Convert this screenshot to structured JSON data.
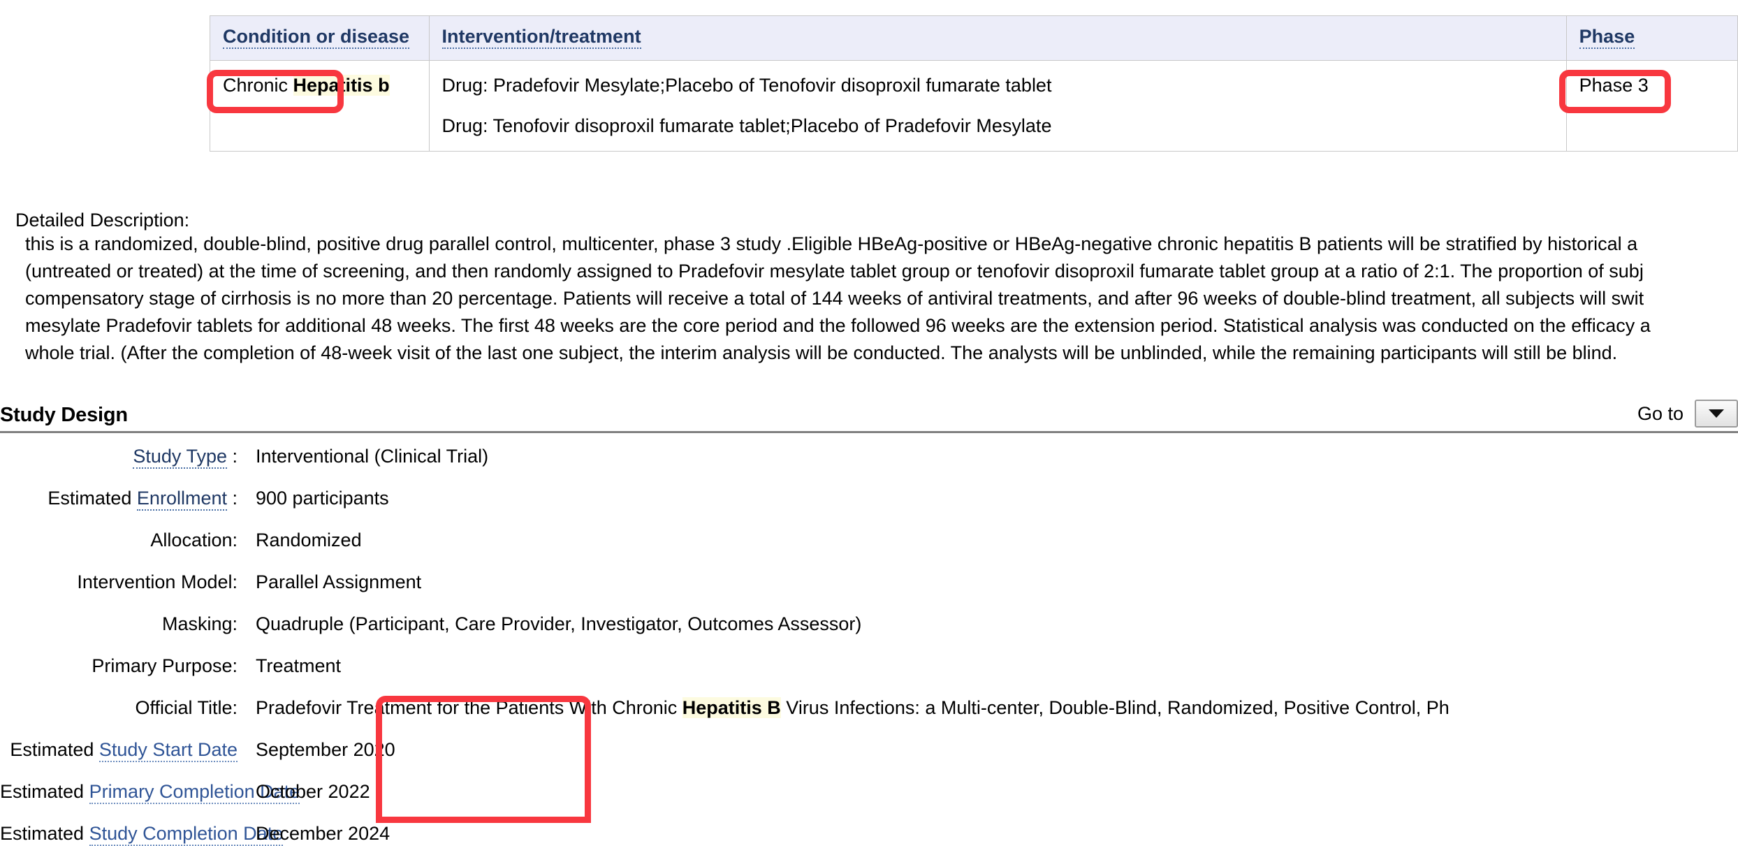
{
  "table": {
    "headers": [
      {
        "label": "Condition or disease",
        "name": "condition-or-disease"
      },
      {
        "label": "Intervention/treatment",
        "name": "intervention-treatment"
      },
      {
        "label": "Phase",
        "name": "phase"
      }
    ],
    "row": {
      "condition_prefix": "Chronic ",
      "condition_highlight": "Hepatitis b",
      "intervention_line_1": "Drug: Pradefovir Mesylate;Placebo of Tenofovir disoproxil fumarate tablet",
      "intervention_line_2": "Drug: Tenofovir disoproxil fumarate tablet;Placebo of Pradefovir Mesylate",
      "phase": "Phase 3"
    }
  },
  "detailed_description": {
    "label": "Detailed Description:",
    "line_1": "this is a randomized, double-blind, positive drug parallel control, multicenter, phase 3 study .Eligible HBeAg-positive or HBeAg-negative chronic hepatitis B patients will be stratified by historical a",
    "line_2": "(untreated or treated) at the time of screening, and then randomly assigned to Pradefovir mesylate tablet group or tenofovir disoproxil fumarate tablet group at a ratio of 2:1. The proportion of subj",
    "line_3": "compensatory stage of cirrhosis is no more than 20 percentage. Patients will receive a total of 144 weeks of antiviral treatments, and after 96 weeks of double-blind treatment, all subjects will swit",
    "line_4": "mesylate Pradefovir tablets for additional 48 weeks. The first 48 weeks are the core period and the followed 96 weeks are the extension period. Statistical analysis was conducted on the efficacy a",
    "line_5": "whole trial. (After the completion of 48-week visit of the last one subject, the interim analysis will be conducted. The analysts will be unblinded, while the remaining participants will still be blind."
  },
  "study_design": {
    "title": "Study Design",
    "goto_label": "Go to",
    "goto_icon": "chevron-down-icon",
    "rows": {
      "study_type": {
        "label": "Study Type",
        "suffix": " :",
        "value": "Interventional  (Clinical Trial)"
      },
      "enrollment": {
        "prefix": "Estimated ",
        "label": "Enrollment",
        "suffix": " :",
        "value": "900 participants"
      },
      "allocation": {
        "label": "Allocation:",
        "value": "Randomized"
      },
      "intervention_model": {
        "label": "Intervention Model:",
        "value": "Parallel Assignment"
      },
      "masking": {
        "label": "Masking:",
        "value": "Quadruple (Participant, Care Provider, Investigator, Outcomes Assessor)"
      },
      "primary_purpose": {
        "label": "Primary Purpose:",
        "value": "Treatment"
      },
      "official_title": {
        "label": "Official Title:",
        "value_part_1": "Pradefovir Treatment for the Patients With Chronic ",
        "value_highlight": "Hepatitis B",
        "value_part_2": " Virus Infections: a Multi-center, Double-Blind, Randomized, Positive Control, Ph"
      },
      "study_start_date": {
        "prefix": "Estimated ",
        "label": "Study Start Date",
        "value": "September 2020"
      },
      "primary_completion_date": {
        "prefix": "Estimated ",
        "label": "Primary Completion Date",
        "value": "October 2022"
      },
      "study_completion_date": {
        "prefix": "Estimated ",
        "label": "Study Completion Date",
        "value": "December 2024"
      }
    }
  },
  "annotations": {
    "color": "#f8373f",
    "boxes": [
      {
        "name": "annotation-box-condition"
      },
      {
        "name": "annotation-box-phase"
      },
      {
        "name": "annotation-box-dates"
      }
    ]
  }
}
